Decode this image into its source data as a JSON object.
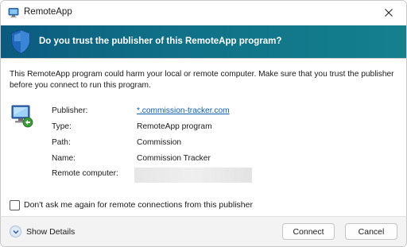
{
  "window": {
    "title": "RemoteApp",
    "close_glyph": "✕"
  },
  "banner": {
    "text": "Do you trust the publisher of this RemoteApp program?",
    "icon": "shield-icon",
    "gradient_start": "#0c5a7f",
    "gradient_end": "#14808e"
  },
  "warning": {
    "text": "This RemoteApp program could harm your local or remote computer. Make sure that you trust the publisher before you connect to run this program."
  },
  "details": {
    "icon": "remote-computer-icon",
    "publisher_label": "Publisher:",
    "publisher_value": "*.commission-tracker.com",
    "type_label": "Type:",
    "type_value": "RemoteApp program",
    "path_label": "Path:",
    "path_value": "Commission",
    "name_label": "Name:",
    "name_value": "Commission Tracker",
    "remote_computer_label": "Remote computer:"
  },
  "checkbox": {
    "label": "Don't ask me again for remote connections from this publisher",
    "checked": false
  },
  "footer": {
    "show_details_label": "Show Details",
    "connect_label": "Connect",
    "cancel_label": "Cancel"
  }
}
